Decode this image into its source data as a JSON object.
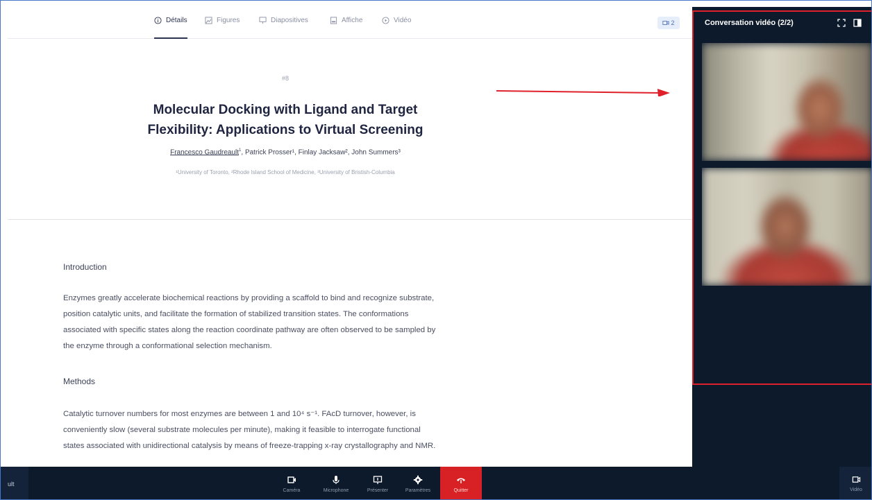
{
  "tabs": [
    {
      "label": "Détails",
      "icon": "info-icon",
      "active": true
    },
    {
      "label": "Figures",
      "icon": "image-icon",
      "active": false
    },
    {
      "label": "Diapositives",
      "icon": "presentation-icon",
      "active": false
    },
    {
      "label": "Affiche",
      "icon": "poster-icon",
      "active": false
    },
    {
      "label": "Vidéo",
      "icon": "play-icon",
      "active": false
    }
  ],
  "camera_badge": "2",
  "article": {
    "number": "#8",
    "title_line1": "Molecular Docking with Ligand and Target",
    "title_line2": "Flexibility: Applications to Virtual Screening",
    "author_first": "Francesco Gaudreault",
    "author_first_sup": "1",
    "authors_rest": ", Patrick Prosser¹, Finlay Jacksaw², John Summers³",
    "affiliations": "¹University of Toronto, ²Rhode Island School of Medicine, ³University of Bristish-Columbia",
    "intro_heading": "Introduction",
    "intro_lines": [
      "Enzymes greatly accelerate biochemical reactions by providing a scaffold to bind and recognize substrate,",
      "position catalytic units, and facilitate the formation of stabilized transition states. The conformations",
      "associated with specific states along the reaction coordinate pathway are often observed to be sampled by",
      "the enzyme through a conformational selection mechanism."
    ],
    "methods_heading": "Methods",
    "methods_lines": [
      "Catalytic turnover numbers for most enzymes are between 1 and 10⁴ s⁻¹. FAcD turnover, however, is",
      "conveniently slow (several substrate molecules per minute), making it feasible to interrogate functional",
      "states associated with unidirectional catalysis by means of freeze-trapping x-ray crystallography and NMR."
    ]
  },
  "video_panel": {
    "title": "Conversation vidéo (2/2)",
    "fullscreen_icon": "fullscreen-icon",
    "popout_icon": "popout-icon"
  },
  "bottom_bar": {
    "left_text": "ult",
    "controls": [
      {
        "label": "Caméra",
        "icon": "camera-icon"
      },
      {
        "label": "Microphone",
        "icon": "microphone-icon"
      },
      {
        "label": "Présenter",
        "icon": "present-icon"
      },
      {
        "label": "Paramètres",
        "icon": "gear-icon"
      },
      {
        "label": "Quitter",
        "icon": "hangup-icon"
      }
    ],
    "right_label": "Vidéo"
  },
  "colors": {
    "accent_red": "#e0202a",
    "quit_red": "#d72124",
    "panel_dark": "#0d1a2b",
    "title_text": "#1f2540"
  }
}
